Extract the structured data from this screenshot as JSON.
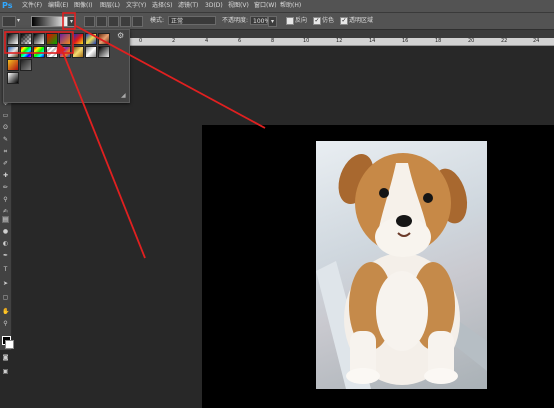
{
  "app": {
    "logo": "Ps"
  },
  "menu": [
    "文件(F)",
    "编辑(E)",
    "图像(I)",
    "图层(L)",
    "文字(Y)",
    "选择(S)",
    "滤镜(T)",
    "3D(D)",
    "视图(V)",
    "窗口(W)",
    "帮助(H)"
  ],
  "options": {
    "mode_label": "模式:",
    "mode_value": "正常",
    "opacity_label": "不透明度:",
    "opacity_value": "100%",
    "reverse_label": "反向",
    "dither_label": "仿色",
    "transparency_label": "透明区域",
    "reverse_checked": false,
    "dither_checked": true,
    "transparency_checked": true
  },
  "ruler_ticks": [
    "0",
    "2",
    "4",
    "6",
    "8",
    "10",
    "12",
    "14",
    "16",
    "18",
    "20",
    "22",
    "24"
  ],
  "gradient_presets": [
    "fg-to-bg",
    "fg-to-transparent",
    "black-white",
    "red-green",
    "violet-orange",
    "blue-red-yellow",
    "blue-yellow-blue",
    "copper",
    "chrome",
    "spectrum",
    "transparent-rainbow",
    "transparent-stripes",
    "yellow-violet-orange-blue",
    "gold",
    "silver",
    "black-transparent",
    "dark-red",
    "white-black"
  ],
  "colors": {
    "accent": "#31a8ff",
    "annotation": "#e02020",
    "canvas": "#000000"
  }
}
